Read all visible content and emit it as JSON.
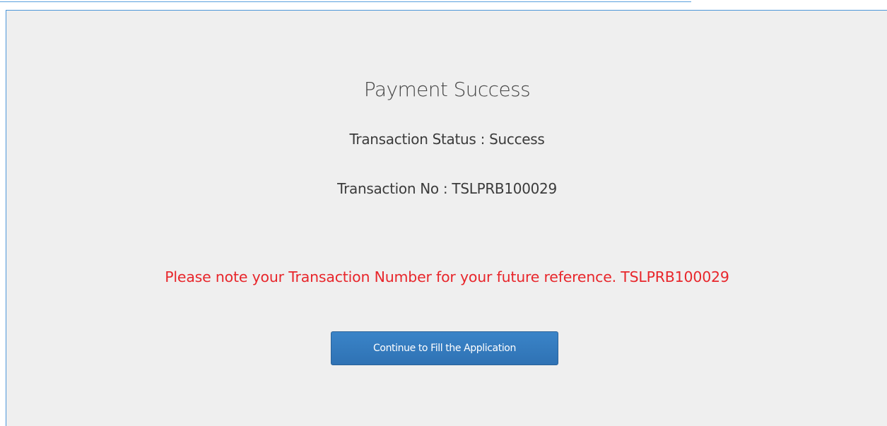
{
  "payment": {
    "title": "Payment Success",
    "status_line": "Transaction Status : Success",
    "transaction_line": "Transaction No : TSLPRB100029",
    "note": "Please note your Transaction Number for your future reference. TSLPRB100029",
    "continue_label": "Continue to Fill the Application"
  },
  "colors": {
    "panel_background": "#efefef",
    "panel_border": "#4d96d9",
    "note_text": "#e8262b",
    "button_background": "#337ab7",
    "button_text": "#ffffff"
  }
}
